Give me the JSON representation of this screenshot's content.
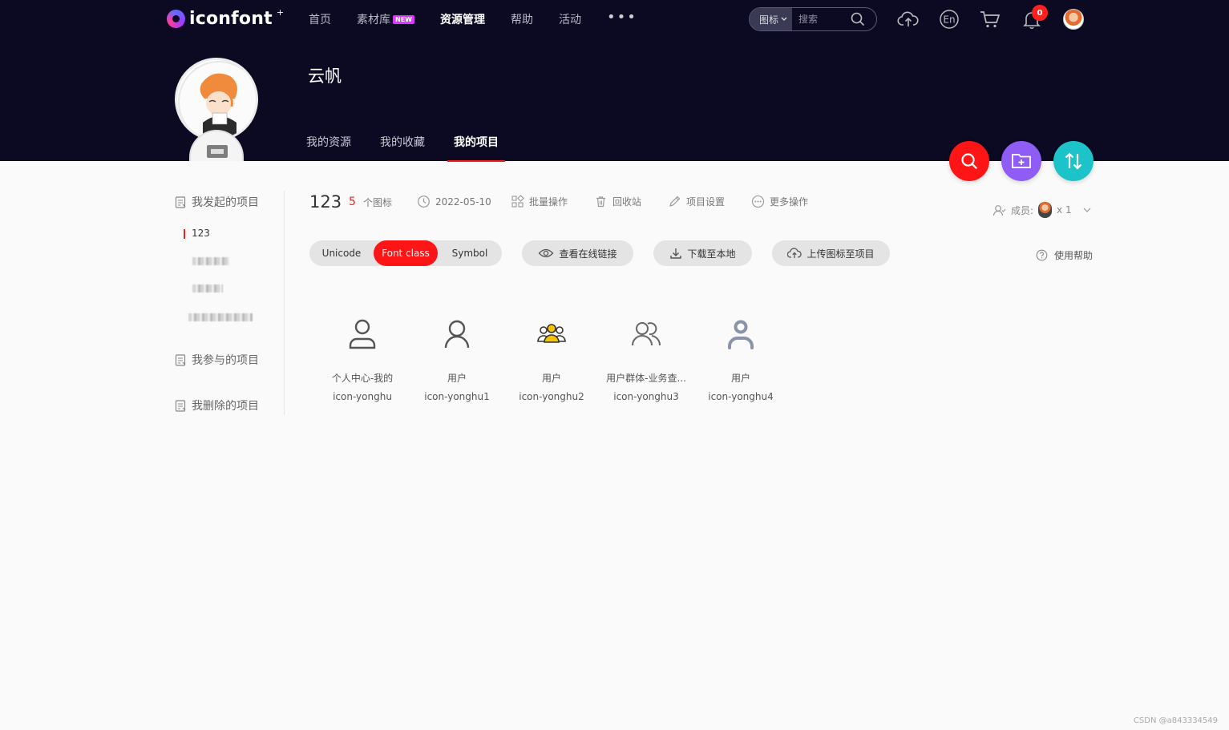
{
  "header": {
    "logo_text": "iconfont",
    "logo_sup": "+",
    "nav": [
      {
        "label": "首页",
        "active": false
      },
      {
        "label": "素材库",
        "badge": "NEW",
        "active": false
      },
      {
        "label": "资源管理",
        "active": true
      },
      {
        "label": "帮助",
        "active": false
      },
      {
        "label": "活动",
        "active": false
      }
    ],
    "more": "•••",
    "search": {
      "type_label": "图标",
      "placeholder": "搜索"
    },
    "notification_count": "0",
    "icons": [
      "upload-cloud-icon",
      "language-en-icon",
      "cart-icon",
      "bell-icon",
      "user-avatar"
    ]
  },
  "profile": {
    "username": "云帆",
    "tabs": [
      {
        "label": "我的资源",
        "active": false
      },
      {
        "label": "我的收藏",
        "active": false
      },
      {
        "label": "我的项目",
        "active": true
      }
    ]
  },
  "fab": [
    {
      "name": "search-fab",
      "color": "#ff1515"
    },
    {
      "name": "new-folder-fab",
      "color": "#8f5cf5"
    },
    {
      "name": "sort-fab",
      "color": "#1cc4c9"
    }
  ],
  "sidebar": {
    "initiated": "我发起的项目",
    "projects": [
      {
        "label": "123",
        "active": true
      }
    ],
    "participated": "我参与的项目",
    "deleted": "我删除的项目"
  },
  "project": {
    "name": "123",
    "icon_count": "5",
    "icon_count_label": "个图标",
    "date": "2022-05-10",
    "actions": [
      "批量操作",
      "回收站",
      "项目设置",
      "更多操作"
    ],
    "members_label": "成员:",
    "members_count": "x 1"
  },
  "toolbar": {
    "segments": [
      {
        "label": "Unicode",
        "active": false
      },
      {
        "label": "Font class",
        "active": true
      },
      {
        "label": "Symbol",
        "active": false
      }
    ],
    "view_link": "查看在线链接",
    "download": "下载至本地",
    "upload": "上传图标至项目",
    "help": "使用帮助"
  },
  "icons": [
    {
      "name": "个人中心-我的",
      "code": "icon-yonghu",
      "glyph": "person-outline-icon"
    },
    {
      "name": "用户",
      "code": "icon-yonghu1",
      "glyph": "user-thin-icon"
    },
    {
      "name": "用户",
      "code": "icon-yonghu2",
      "glyph": "user-group-yellow-icon"
    },
    {
      "name": "用户群体-业务查...",
      "code": "icon-yonghu3",
      "glyph": "user-group-outline-icon"
    },
    {
      "name": "用户",
      "code": "icon-yonghu4",
      "glyph": "user-solid-gray-icon"
    }
  ],
  "watermark": "CSDN @a843334549"
}
